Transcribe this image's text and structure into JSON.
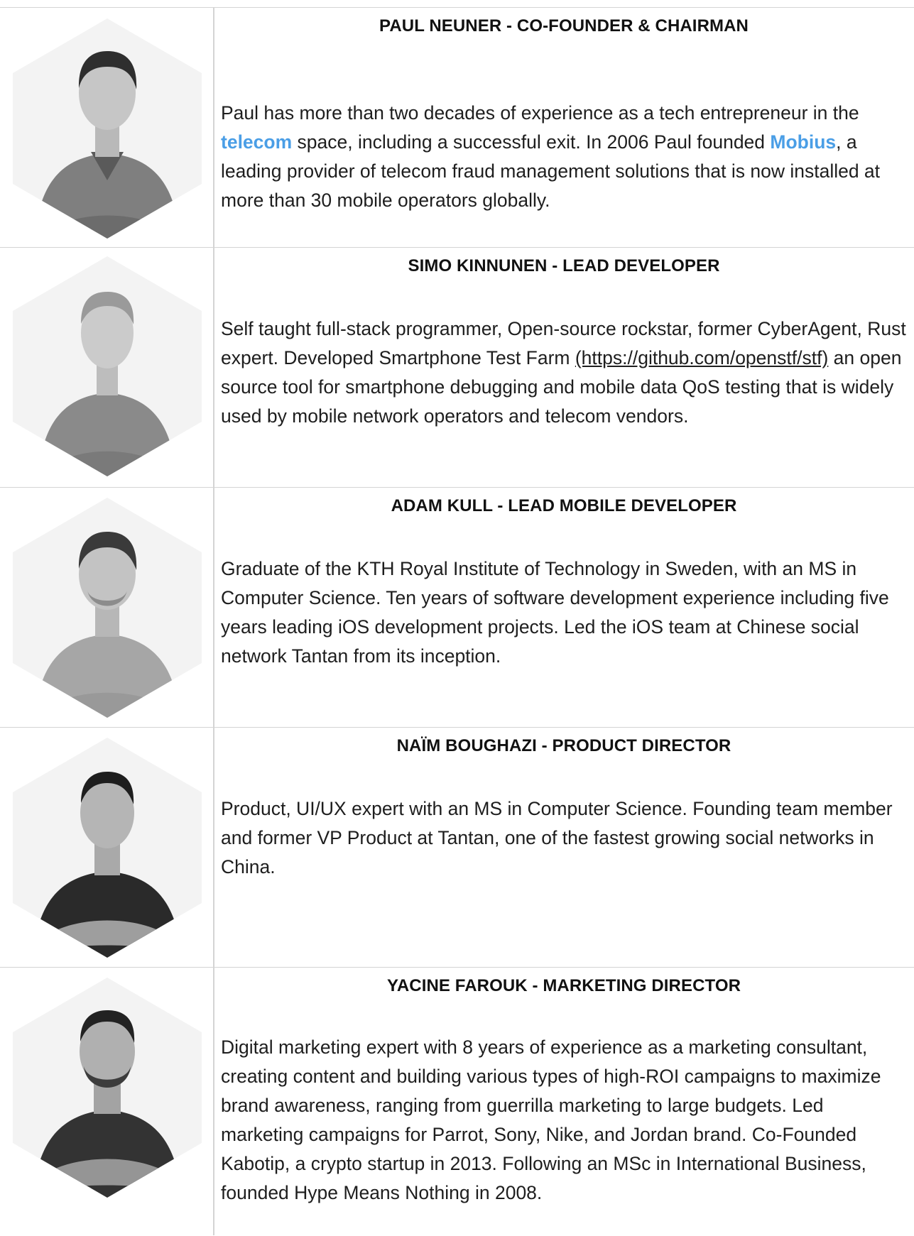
{
  "members": [
    {
      "name": "PAUL NEUNER - CO-FOUNDER & CHAIRMAN",
      "bio_parts": [
        "Paul has more than two decades of experience as a tech entrepreneur in the ",
        "telecom",
        " space, including a successful exit. In 2006 Paul founded ",
        "Mobius",
        ", a leading provider of telecom fraud management solutions that is now installed at more than 30 mobile operators globally."
      ]
    },
    {
      "name": "SIMO KINNUNEN - LEAD DEVELOPER",
      "bio_parts": [
        "Self taught full-stack programmer, Open-source rockstar, former CyberAgent, Rust expert. Developed Smartphone Test Farm ",
        "(https://github.com/openstf/stf)",
        " an open source tool for smartphone debugging and mobile data QoS testing that is widely used by mobile network operators and telecom vendors."
      ]
    },
    {
      "name": "ADAM KULL - LEAD MOBILE DEVELOPER",
      "bio": "Graduate of the KTH Royal Institute of Technology in Sweden, with an MS in Computer Science. Ten years of software development experience including five years leading iOS development projects. Led the iOS team at Chinese social network Tantan from its inception."
    },
    {
      "name": "NAÏM BOUGHAZI - PRODUCT DIRECTOR",
      "bio": "Product, UI/UX expert with an MS in Computer Science. Founding team member and former VP Product at Tantan, one of the fastest growing social networks in China."
    },
    {
      "name": "YACINE FAROUK - MARKETING DIRECTOR",
      "bio": "Digital marketing expert with 8 years of experience as a marketing consultant, creating content and building various types of high-ROI campaigns to maximize brand awareness, ranging from guerrilla marketing to large budgets. Led marketing campaigns for Parrot, Sony, Nike, and Jordan brand. Co-Founded Kabotip, a crypto startup in 2013. Following an MSc in International Business, founded Hype Means Nothing in 2008."
    }
  ],
  "colors": {
    "link_highlight": "#4a9ee6",
    "grid_line": "#d4d4d4"
  }
}
